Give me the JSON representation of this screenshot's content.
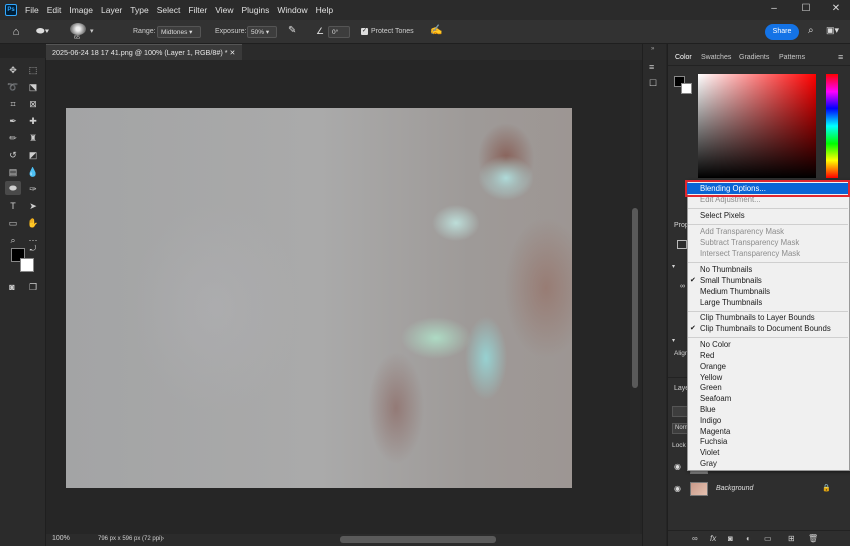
{
  "menubar": {
    "items": [
      "File",
      "Edit",
      "Image",
      "Layer",
      "Type",
      "Select",
      "Filter",
      "View",
      "Plugins",
      "Window",
      "Help"
    ]
  },
  "options": {
    "brush_size": "65",
    "range_label": "Range:",
    "range_value": "Midtones",
    "exposure_label": "Exposure:",
    "exposure_value": "50%",
    "angle_value": "0°",
    "protect_tones_label": "Protect Tones",
    "share_label": "Share"
  },
  "document": {
    "tab_title": "2025-06-24 18 17 41.png @ 100% (Layer 1, RGB/8#) *"
  },
  "status": {
    "zoom": "100%",
    "dimensions": "796 px x 596 px (72 ppi)"
  },
  "panels": {
    "color_tabs": [
      "Color",
      "Swatches",
      "Gradients",
      "Patterns"
    ],
    "properties_label": "Prop",
    "align_label": "Align",
    "layers_label": "Laye",
    "normal_label": "Norm",
    "lock_label": "Lock",
    "background_layer": "Background"
  },
  "context_menu": {
    "items": [
      {
        "label": "Blending Options...",
        "state": "highlighted"
      },
      {
        "label": "Edit Adjustment...",
        "state": "disabled"
      },
      {
        "label": "Select Pixels",
        "state": "normal"
      },
      {
        "label": "Add Transparency Mask",
        "state": "disabled"
      },
      {
        "label": "Subtract Transparency Mask",
        "state": "disabled"
      },
      {
        "label": "Intersect Transparency Mask",
        "state": "disabled"
      },
      {
        "label": "No Thumbnails",
        "state": "normal"
      },
      {
        "label": "Small Thumbnails",
        "state": "checked"
      },
      {
        "label": "Medium Thumbnails",
        "state": "normal"
      },
      {
        "label": "Large Thumbnails",
        "state": "normal"
      },
      {
        "label": "Clip Thumbnails to Layer Bounds",
        "state": "normal"
      },
      {
        "label": "Clip Thumbnails to Document Bounds",
        "state": "checked"
      },
      {
        "label": "No Color",
        "state": "normal"
      },
      {
        "label": "Red",
        "state": "normal"
      },
      {
        "label": "Orange",
        "state": "normal"
      },
      {
        "label": "Yellow",
        "state": "normal"
      },
      {
        "label": "Green",
        "state": "normal"
      },
      {
        "label": "Seafoam",
        "state": "normal"
      },
      {
        "label": "Blue",
        "state": "normal"
      },
      {
        "label": "Indigo",
        "state": "normal"
      },
      {
        "label": "Magenta",
        "state": "normal"
      },
      {
        "label": "Fuchsia",
        "state": "normal"
      },
      {
        "label": "Violet",
        "state": "normal"
      },
      {
        "label": "Gray",
        "state": "normal"
      }
    ]
  },
  "colors": {
    "accent": "#1473e6",
    "highlight": "#0a64d4",
    "callout": "#e0262e"
  },
  "icons": {
    "home": "home-icon",
    "tool": "dodge-tool-icon",
    "search": "search-icon"
  }
}
